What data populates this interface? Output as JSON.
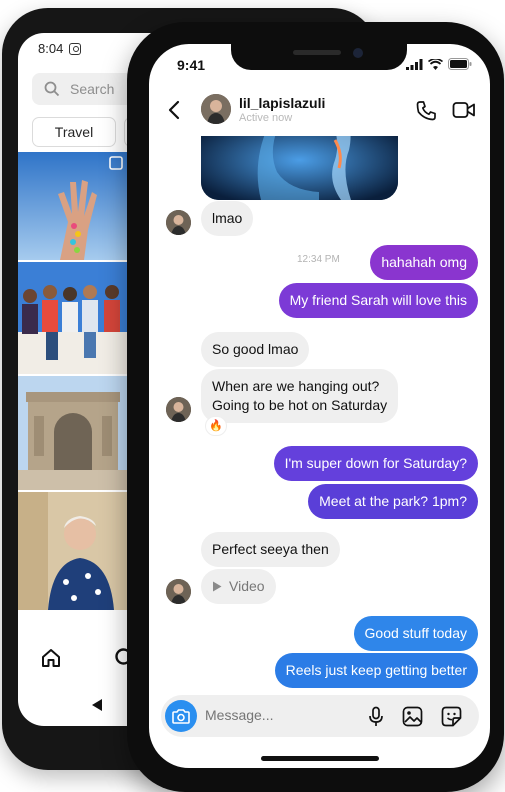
{
  "android": {
    "time": "8:04",
    "search_placeholder": "Search",
    "chips": [
      "Travel"
    ]
  },
  "iphone": {
    "time": "9:41",
    "username": "lil_lapislazuli",
    "status": "Active now",
    "messages": [
      {
        "text": "lmao",
        "side": "in"
      },
      {
        "text": "hahahah omg",
        "side": "out"
      },
      {
        "text": "My friend Sarah will love this",
        "side": "out"
      },
      {
        "text": "So good lmao",
        "side": "in"
      },
      {
        "text": "When are we hanging out?",
        "side": "in"
      },
      {
        "text": "Going to be hot on Saturday",
        "side": "in"
      },
      {
        "text": "🔥",
        "side": "reaction"
      },
      {
        "text": "I'm super down for Saturday?",
        "side": "out"
      },
      {
        "text": "Meet at the park? 1pm?",
        "side": "out"
      },
      {
        "text": "Perfect seeya then",
        "side": "in"
      },
      {
        "text": "Video",
        "side": "in"
      },
      {
        "text": "Good stuff today",
        "side": "out"
      },
      {
        "text": "Reels just keep getting better",
        "side": "out"
      }
    ],
    "timestamp": "12:34 PM",
    "composer_placeholder": "Message...",
    "colors": {
      "purple": "#7a3ad7",
      "indigo": "#5d40d8",
      "blue": "#2f7de8",
      "incoming": "#efefef"
    }
  }
}
